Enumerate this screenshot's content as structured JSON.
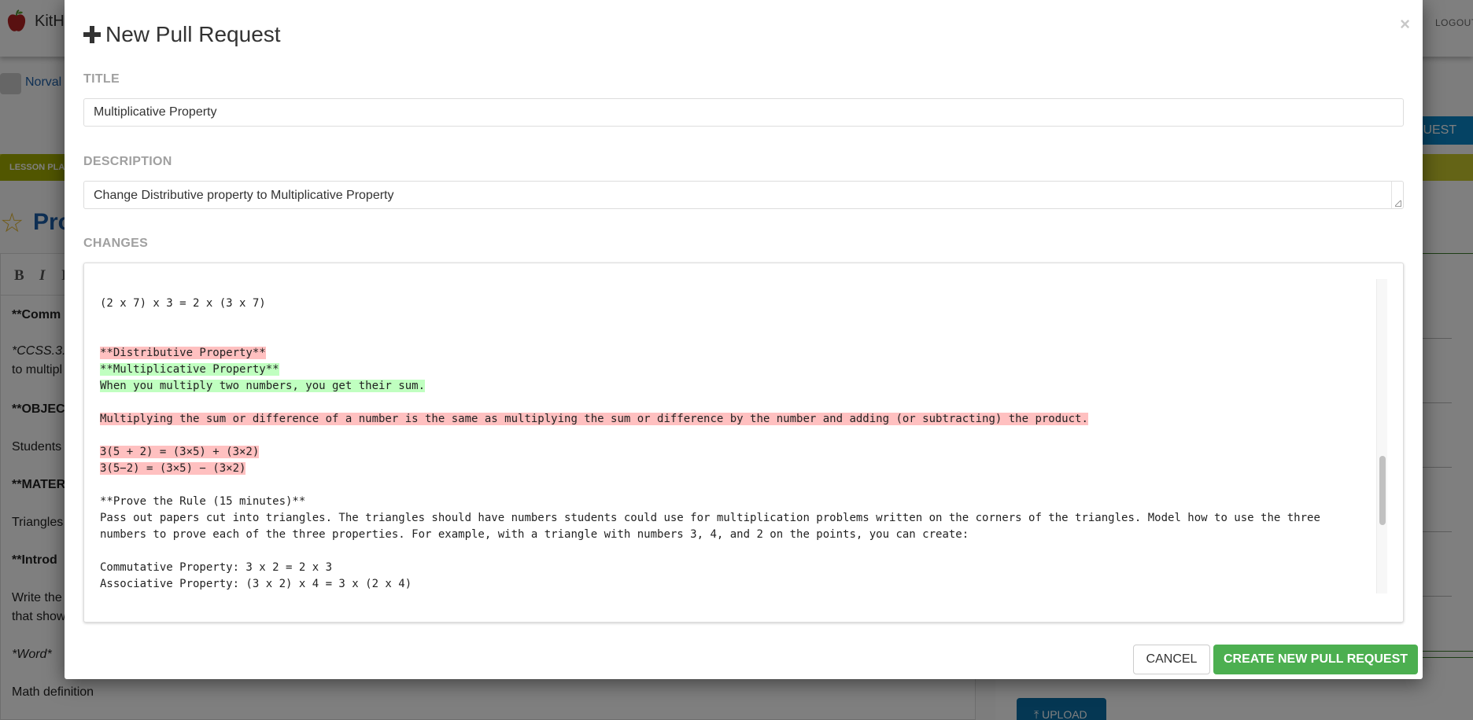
{
  "background": {
    "brand": "KitH",
    "logout": "LOGOUT",
    "user_name": "Norval",
    "pull_request_button": "QUEST",
    "lesson_tab": "LESSON PLA",
    "doc_title": "Pro",
    "toolbar": {
      "bold": "B",
      "italic": "I",
      "third": "I"
    },
    "editor_lines": [
      {
        "text": "**Comm",
        "style": "bold"
      },
      {
        "text": "*CCSS.3.",
        "style": "ital"
      },
      {
        "text": "to multipl",
        "style": ""
      },
      {
        "text": "**OBJEC",
        "style": "bold"
      },
      {
        "text": "Students",
        "style": ""
      },
      {
        "text": "**MATER",
        "style": "bold"
      },
      {
        "text": "Triangles",
        "style": ""
      },
      {
        "text": "**Introd",
        "style": "bold"
      },
      {
        "text": "Write the",
        "style": ""
      },
      {
        "text": "that show",
        "style": ""
      },
      {
        "text": "*Word*",
        "style": "ital"
      },
      {
        "text": "Math definition",
        "style": ""
      }
    ],
    "upload_button": "UPLOAD"
  },
  "modal": {
    "title": "New Pull Request",
    "close_symbol": "×",
    "title_label": "TITLE",
    "title_value": "Multiplicative Property",
    "description_label": "DESCRIPTION",
    "description_value": "Change Distributive property to Multiplicative Property",
    "changes_label": "CHANGES",
    "diff_lines": [
      {
        "type": "context",
        "text": "(2 x 7) x 3 = 2 x (3 x 7)"
      },
      {
        "type": "blank",
        "text": ""
      },
      {
        "type": "blank",
        "text": ""
      },
      {
        "type": "removed",
        "text": "**Distributive Property**"
      },
      {
        "type": "added",
        "text": "**Multiplicative Property**"
      },
      {
        "type": "added",
        "text": "When you multiply two numbers, you get their sum."
      },
      {
        "type": "blank",
        "text": ""
      },
      {
        "type": "removed",
        "text": "Multiplying the sum or difference of a number is the same as multiplying the sum or difference by the number and adding (or subtracting) the product."
      },
      {
        "type": "blank",
        "text": ""
      },
      {
        "type": "removed",
        "text": "3(5 + 2) = (3×5) + (3×2)"
      },
      {
        "type": "removed",
        "text": "3(5−2) = (3×5) − (3×2)"
      },
      {
        "type": "blank",
        "text": ""
      },
      {
        "type": "context",
        "text": "**Prove the Rule (15 minutes)**"
      },
      {
        "type": "context",
        "text": "Pass out papers cut into triangles. The triangles should have numbers students could use for multiplication problems written on the corners of the triangles. Model how to use the three"
      },
      {
        "type": "context",
        "text": "numbers to prove each of the three properties. For example, with a triangle with numbers 3, 4, and 2 on the points, you can create:"
      },
      {
        "type": "blank",
        "text": ""
      },
      {
        "type": "context",
        "text": "Commutative Property: 3 x 2 = 2 x 3"
      },
      {
        "type": "context",
        "text": "Associative Property: (3 x 2) x 4 = 3 x (2 x 4)"
      }
    ],
    "scroll_position": 0.72,
    "cancel_label": "CANCEL",
    "create_label": "CREATE NEW PULL REQUEST",
    "colors": {
      "removed": "#ffc0c0",
      "added": "#c0ffc0",
      "create_button": "#4caf50"
    }
  }
}
